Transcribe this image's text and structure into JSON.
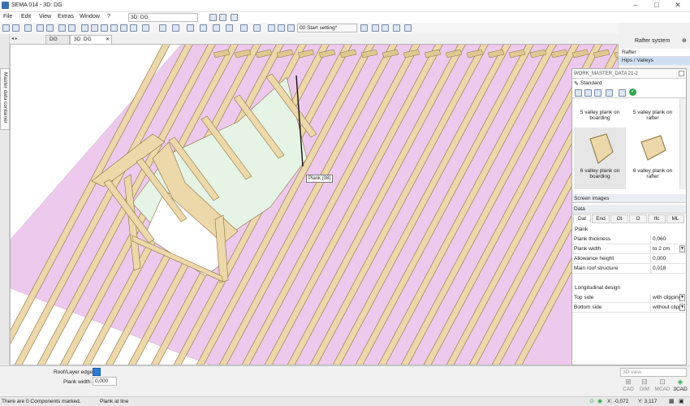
{
  "window": {
    "title": "SEMA 014 - 3D: DG"
  },
  "menu": {
    "items": [
      "File",
      "Edit",
      "View",
      "Extras",
      "Window",
      "?"
    ]
  },
  "toolbar": {
    "view_combo": "3D: DG",
    "setting_combo": "00 Start setting*"
  },
  "sidestrip": {
    "label": "Master data container"
  },
  "tabs": [
    {
      "label": "DG"
    },
    {
      "label": "3D: DG"
    }
  ],
  "viewport": {
    "tooltip": "Plank (08)"
  },
  "rightpanel": {
    "title": "Rafter system",
    "items": [
      {
        "label": "Rafter"
      },
      {
        "label": "Hips / Valleys"
      }
    ]
  },
  "dialog": {
    "title": "WORK_MASTER_DATA 21-2",
    "standard": "Standard",
    "thumbs": [
      {
        "label": "5 valley plank on boarding"
      },
      {
        "label": "5 valley plank on rafter"
      },
      {
        "label": "6 valley plank on boarding"
      },
      {
        "label": "6 valley plank on rafter"
      }
    ],
    "screen_images": "Screen images",
    "data_header": "Data",
    "data_tabs": [
      "Dat",
      "End",
      "Ot",
      "O",
      "Ifc",
      "ML"
    ],
    "group_plank": "Plank",
    "props": [
      {
        "key": "Plank thickness",
        "value": "0,060"
      },
      {
        "key": "Plank width",
        "value": "to 2 cm"
      },
      {
        "key": "Allowance height",
        "value": "0,000"
      },
      {
        "key": "Main roof structure",
        "value": "0,018"
      }
    ],
    "group_long": "Longitudinal design",
    "props2": [
      {
        "key": "Top side",
        "value": "with clipping"
      },
      {
        "key": "Bottom side",
        "value": "without clipp"
      }
    ]
  },
  "bottom": {
    "roof_layer_label": "Roof/Layer edge:",
    "plank_width_label": "Plank width:",
    "plank_width_value": "0,000",
    "view_combo": "3D view",
    "modes": [
      {
        "label": "CAD"
      },
      {
        "label": "DIM"
      },
      {
        "label": "MCAD"
      },
      {
        "label": "3CAD"
      }
    ]
  },
  "status": {
    "left": "There are 0 Components marked.",
    "mid": "Plank at line",
    "x": "X: -0,072",
    "y": "Y: 3,117"
  },
  "colors": {
    "insulation": "#eec9ee",
    "timber": "#ecd8a8",
    "timber_edge": "#8a7040",
    "accent": "#2b7bd6",
    "highlight": "#cfe0f3"
  }
}
